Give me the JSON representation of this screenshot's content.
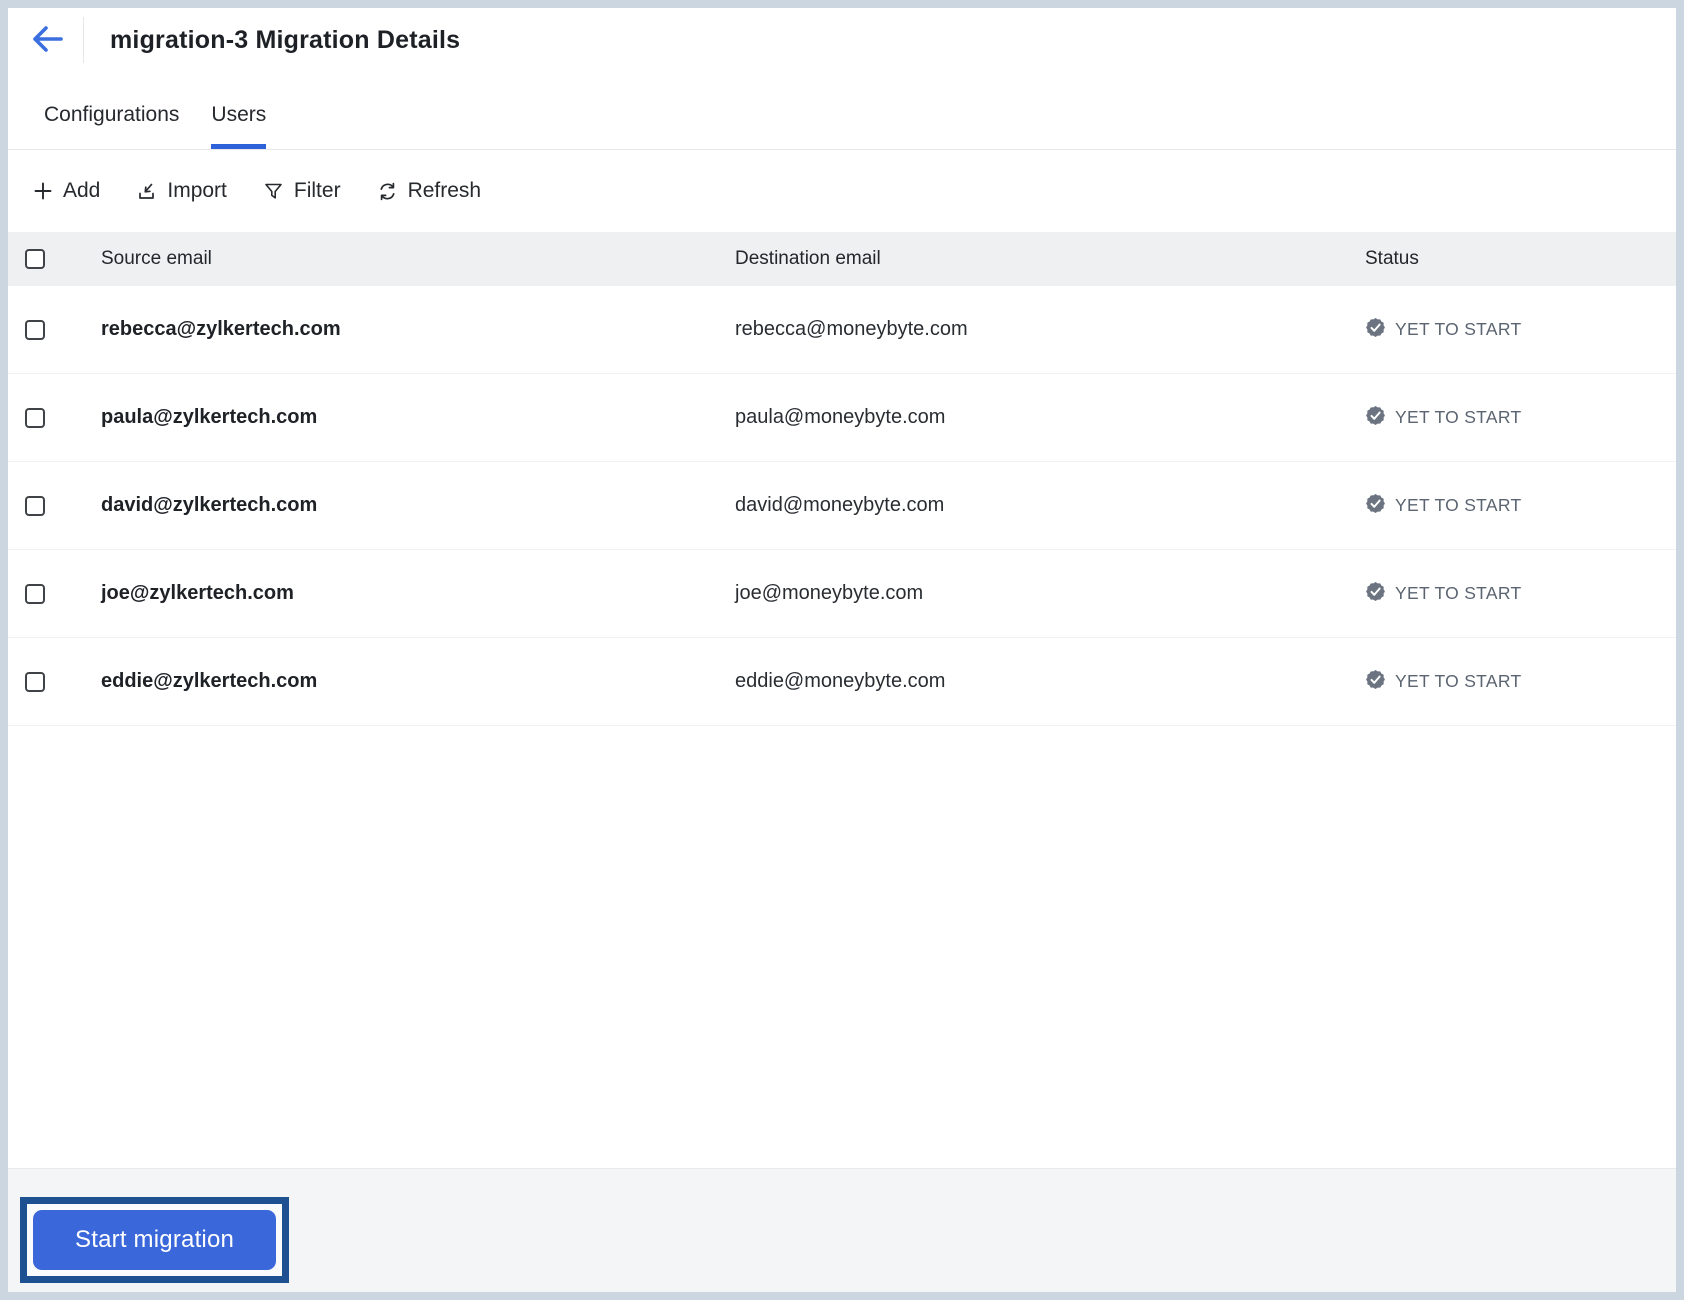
{
  "header": {
    "title": "migration-3 Migration Details"
  },
  "tabs": [
    {
      "label": "Configurations",
      "active": false
    },
    {
      "label": "Users",
      "active": true
    }
  ],
  "toolbar": {
    "add_label": "Add",
    "import_label": "Import",
    "filter_label": "Filter",
    "refresh_label": "Refresh"
  },
  "table": {
    "columns": {
      "source": "Source email",
      "destination": "Destination email",
      "status": "Status"
    },
    "rows": [
      {
        "source": "rebecca@zylkertech.com",
        "destination": "rebecca@moneybyte.com",
        "status": "YET TO START"
      },
      {
        "source": "paula@zylkertech.com",
        "destination": "paula@moneybyte.com",
        "status": "YET TO START"
      },
      {
        "source": "david@zylkertech.com",
        "destination": "david@moneybyte.com",
        "status": "YET TO START"
      },
      {
        "source": "joe@zylkertech.com",
        "destination": "joe@moneybyte.com",
        "status": "YET TO START"
      },
      {
        "source": "eddie@zylkertech.com",
        "destination": "eddie@moneybyte.com",
        "status": "YET TO START"
      }
    ]
  },
  "footer": {
    "start_button_label": "Start migration"
  },
  "colors": {
    "accent_blue": "#3a67d9",
    "tab_underline": "#2d62d9",
    "back_arrow": "#3b6fe0",
    "highlight_border": "#1d5191",
    "status_gray": "#5b6470",
    "badge_gray": "#6b7480",
    "table_header_bg": "#eef0f2",
    "footer_bg": "#f4f5f7",
    "window_border": "#cbd6e0"
  }
}
